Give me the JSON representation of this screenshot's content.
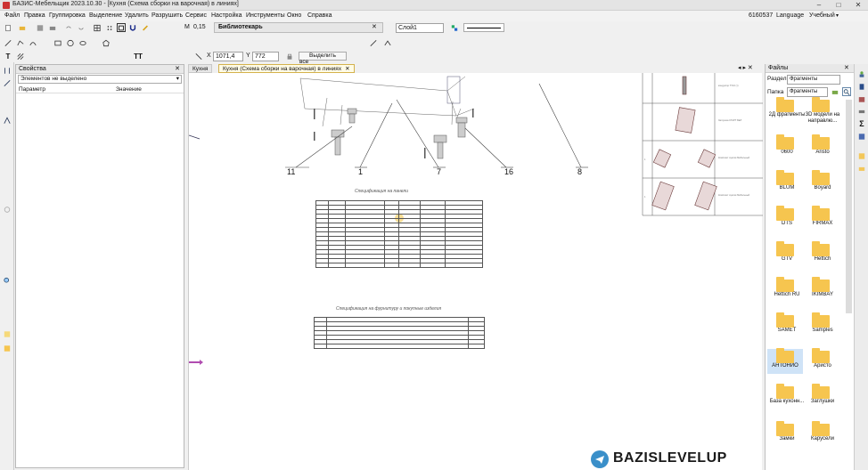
{
  "window": {
    "title": "БАЗИС-Мебельщик 2023.10.30 - [Кухня (Схема сборки на варочная) в линиях]"
  },
  "menu": [
    "Файл",
    "Правка",
    "Группировка",
    "Выделение",
    "Удалить",
    "Разрушить",
    "Сервис",
    "Настройка",
    "Инструменты",
    "Окно",
    "Справка"
  ],
  "topright": {
    "num": "6160537",
    "language": "Language",
    "mode": "Учебный"
  },
  "toolbar": {
    "m_label": "M",
    "m_value": "0,15",
    "library": "Библиотекарь",
    "layer": "Слой1",
    "x_label": "X",
    "x_value": "1071,4",
    "y_label": "Y",
    "y_value": "772",
    "select_all": "Выделить все"
  },
  "props": {
    "title": "Свойства",
    "selected": "Элементов не выделено",
    "col_param": "Параметр",
    "col_value": "Значение"
  },
  "tabs": [
    "Кухня",
    "Кухня (Схема сборки на варочная) в линиях"
  ],
  "drawing": {
    "callouts": [
      "11",
      "1",
      "7",
      "16",
      "8"
    ],
    "table1_title": "Спецификация на панели",
    "table2_title": "Спецификация на фурнитуру и покупные изделия"
  },
  "files": {
    "title": "Файлы",
    "section_label": "Раздел",
    "section_value": "Фрагменты",
    "folder_label": "Папка",
    "folder_value": "Фрагменты",
    "items": [
      "2Д фрагменты",
      "3D модели на направлю...",
      "0600",
      "Aristo",
      "BLUM",
      "Boyard",
      "DTS",
      "FIRMAX",
      "GTV",
      "Hettich",
      "Hettich RU",
      "IKIMBAY",
      "SAMET",
      "Samples",
      "АНТОНИО",
      "Аристо",
      "База кухонн...",
      "Заглушки",
      "Замки",
      "Карусели"
    ]
  },
  "watermark": {
    "text": "BAZISLEVELUP"
  }
}
